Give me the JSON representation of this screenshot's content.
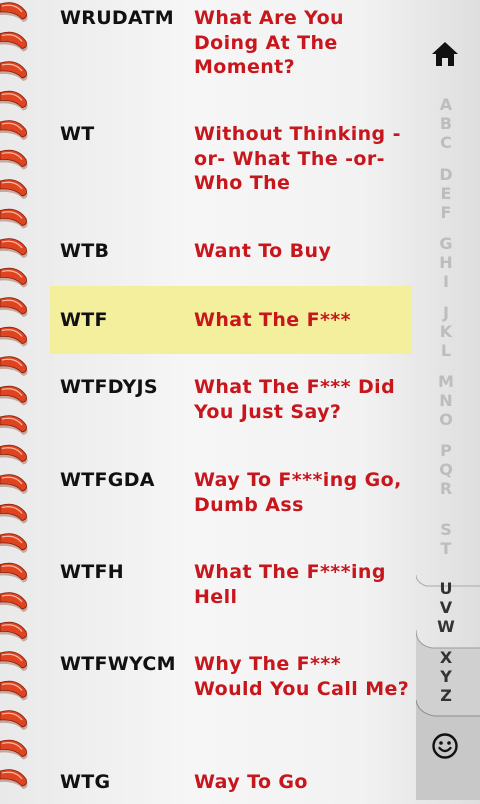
{
  "entries": [
    {
      "abbr": "WRUDATM",
      "meaning": "What Are You Doing At The Moment?",
      "selected": false
    },
    {
      "abbr": "WT",
      "meaning": "Without Thinking -or- What The -or- Who The",
      "selected": false
    },
    {
      "abbr": "WTB",
      "meaning": "Want To Buy",
      "selected": false
    },
    {
      "abbr": "WTF",
      "meaning": "What The F***",
      "selected": true
    },
    {
      "abbr": "WTFDYJS",
      "meaning": "What The F*** Did You Just Say?",
      "selected": false
    },
    {
      "abbr": "WTFGDA",
      "meaning": "Way To F***ing Go, Dumb Ass",
      "selected": false
    },
    {
      "abbr": "WTFH",
      "meaning": "What The F***ing Hell",
      "selected": false
    },
    {
      "abbr": "WTFWYCM",
      "meaning": "Why The F*** Would You Call Me?",
      "selected": false
    },
    {
      "abbr": "WTG",
      "meaning": "Way To Go",
      "selected": false
    }
  ],
  "index_groups": [
    {
      "letters": [
        "A",
        "B",
        "C"
      ],
      "active": false
    },
    {
      "letters": [
        "D",
        "E",
        "F"
      ],
      "active": false
    },
    {
      "letters": [
        "G",
        "H",
        "I"
      ],
      "active": false
    },
    {
      "letters": [
        "J",
        "K",
        "L"
      ],
      "active": false
    },
    {
      "letters": [
        "M",
        "N",
        "O"
      ],
      "active": false
    },
    {
      "letters": [
        "P",
        "Q",
        "R"
      ],
      "active": false
    },
    {
      "letters": [
        "S",
        "T"
      ],
      "active": false
    },
    {
      "letters": [
        "U",
        "V",
        "W"
      ],
      "active": true
    },
    {
      "letters": [
        "X",
        "Y",
        "Z"
      ],
      "active": true
    }
  ],
  "icons": {
    "home": "home-icon",
    "smiley": "smiley-icon"
  },
  "colors": {
    "abbr": "#111111",
    "meaning": "#c8161d",
    "selected_row": "#f3ef9c",
    "spiral": "#e0431f"
  }
}
